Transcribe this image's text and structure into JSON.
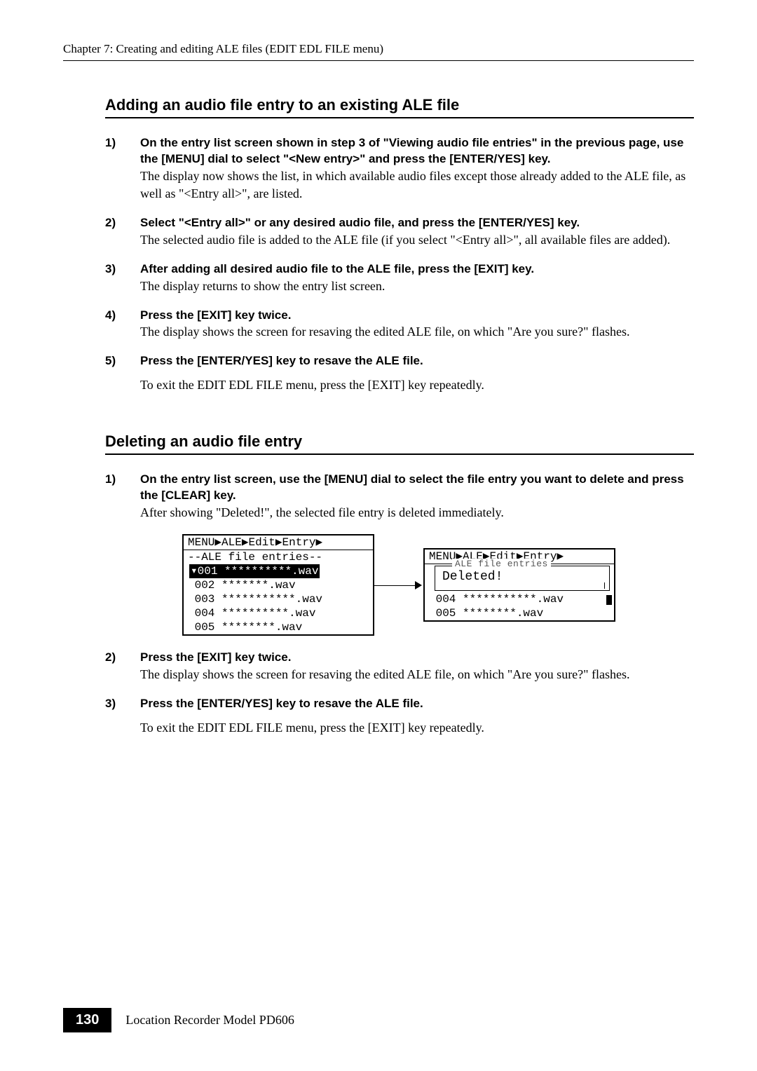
{
  "chapter_header": "Chapter 7: Creating and editing ALE files (EDIT EDL FILE menu)",
  "section1": {
    "title": "Adding an audio file entry to an existing ALE file",
    "steps": [
      {
        "num": "1)",
        "bold": "On the entry list screen shown in step 3 of \"Viewing audio file entries\" in the previous page, use the [MENU] dial to select \"<New entry>\" and press the [ENTER/YES] key.",
        "text": "The display now shows the list, in which available audio files except those already added to the ALE file, as well as \"<Entry all>\", are listed."
      },
      {
        "num": "2)",
        "bold": "Select \"<Entry all>\" or any desired audio file, and press the [ENTER/YES] key.",
        "text": "The selected audio file is added to the ALE file (if you select \"<Entry all>\", all available files are added)."
      },
      {
        "num": "3)",
        "bold": "After adding all desired audio file to the ALE file, press the [EXIT] key.",
        "text": "The display returns to show the entry list screen."
      },
      {
        "num": "4)",
        "bold": "Press the [EXIT] key twice.",
        "text": "The display shows the screen for resaving the edited ALE file, on which \"Are you sure?\" flashes."
      },
      {
        "num": "5)",
        "bold": "Press the [ENTER/YES] key to resave the ALE file.",
        "text": "",
        "after": "To exit the EDIT EDL FILE menu, press the [EXIT] key repeatedly."
      }
    ]
  },
  "section2": {
    "title": "Deleting an audio file entry",
    "steps": [
      {
        "num": "1)",
        "bold": "On the entry list screen, use the [MENU] dial to select the file entry you want to delete and press the [CLEAR] key.",
        "text": "After showing \"Deleted!\", the selected file entry is deleted immediately."
      },
      {
        "num": "2)",
        "bold": "Press the [EXIT] key twice.",
        "text": "The display shows the screen for resaving the edited ALE file, on which \"Are you sure?\" flashes."
      },
      {
        "num": "3)",
        "bold": "Press the [ENTER/YES] key to resave the ALE file.",
        "text": "",
        "after": "To exit the EDIT EDL FILE menu, press the [EXIT] key repeatedly."
      }
    ]
  },
  "lcd": {
    "breadcrumb": "MENU▶ALE▶Edit▶Entry▶",
    "header": "--ALE file entries--",
    "entries_left": [
      "▾001 **********.wav",
      " 002 *******.wav",
      " 003 ***********.wav",
      " 004 **********.wav",
      " 005 ********.wav"
    ],
    "popup_hint": "ALE file entries",
    "popup_text": "Deleted!",
    "entries_right_after": [
      " 004 ***********.wav",
      " 005 ********.wav"
    ]
  },
  "footer": {
    "page": "130",
    "text": "Location Recorder  Model PD606"
  }
}
